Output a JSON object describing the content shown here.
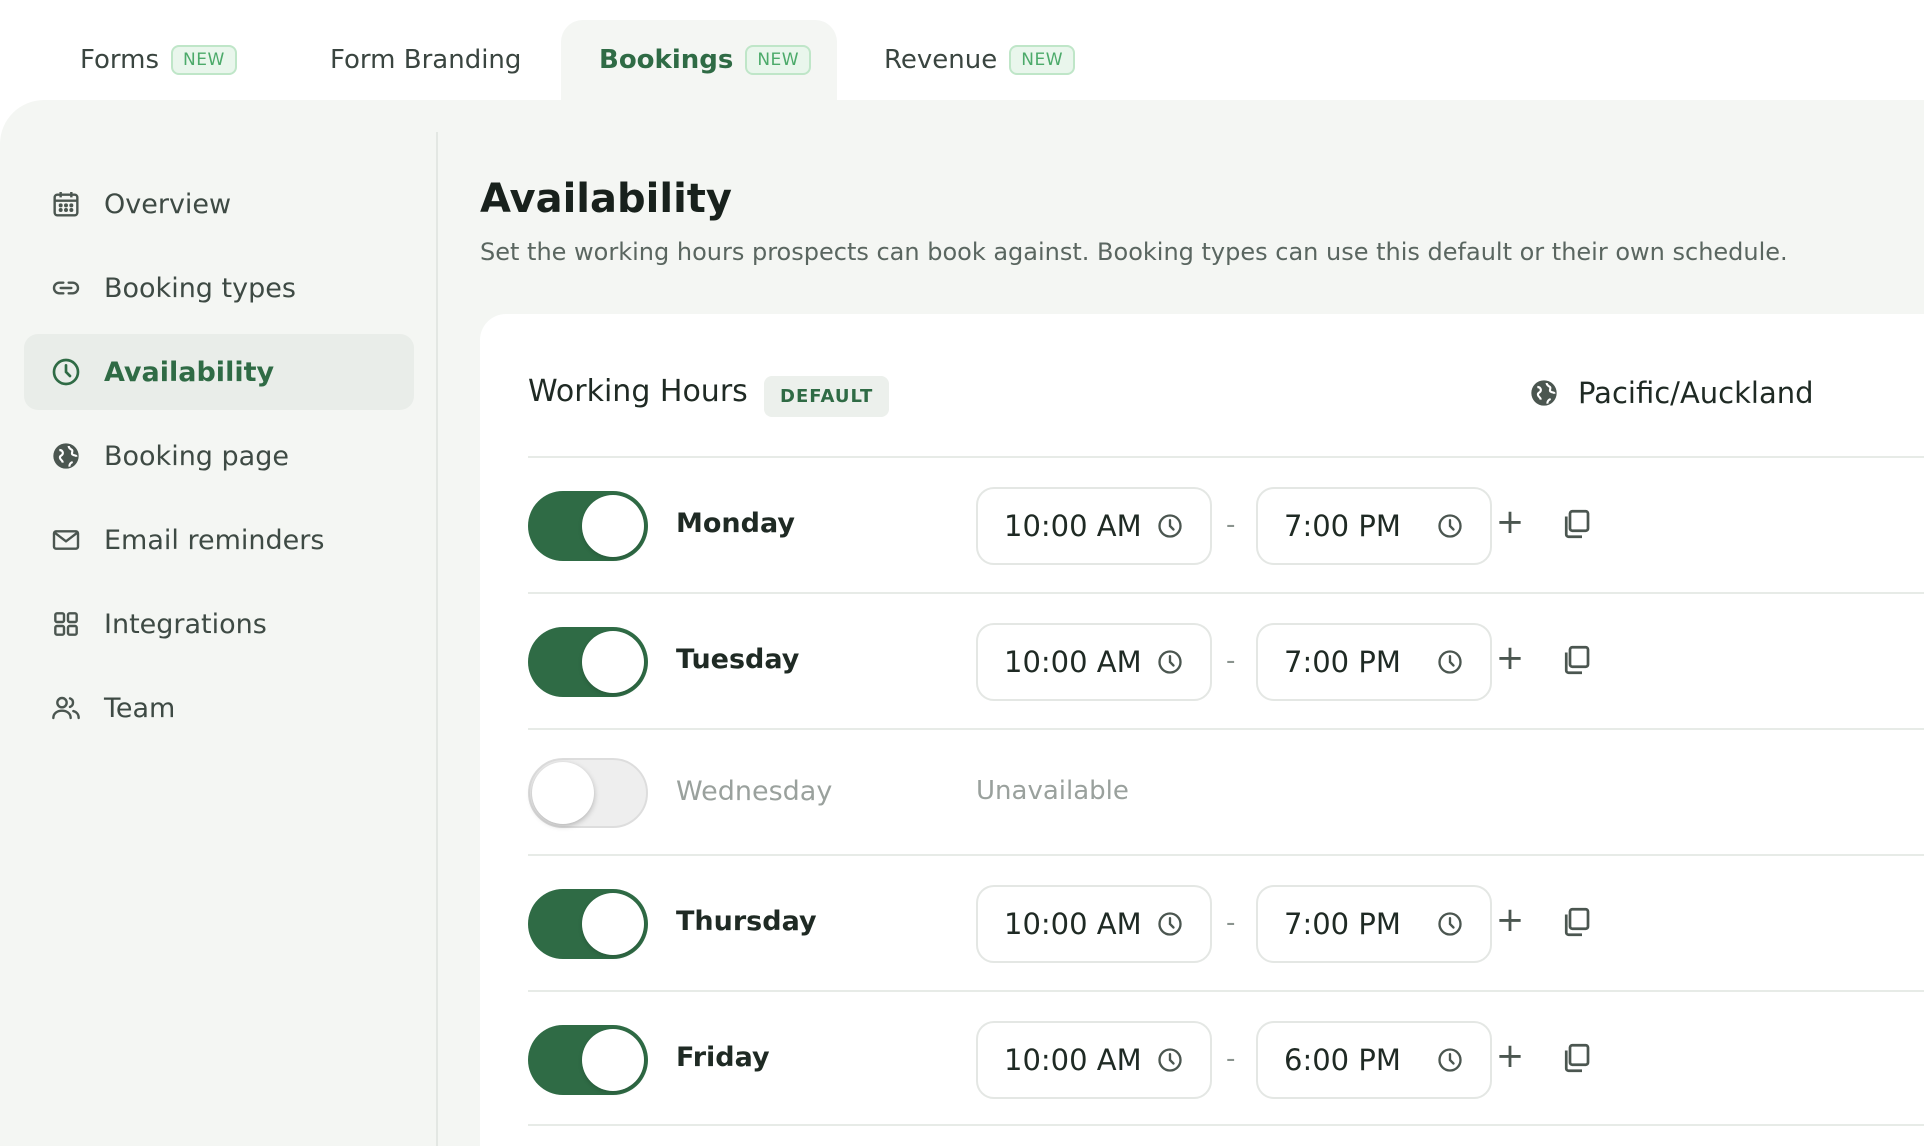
{
  "tabs": [
    {
      "label": "Forms",
      "badge": "NEW"
    },
    {
      "label": "Form Branding",
      "badge": ""
    },
    {
      "label": "Bookings",
      "badge": "NEW"
    },
    {
      "label": "Revenue",
      "badge": "NEW"
    }
  ],
  "sidebar": {
    "items": [
      {
        "label": "Overview",
        "icon": "calendar-icon"
      },
      {
        "label": "Booking types",
        "icon": "link-icon"
      },
      {
        "label": "Availability",
        "icon": "clock-icon"
      },
      {
        "label": "Booking page",
        "icon": "globe-icon"
      },
      {
        "label": "Email reminders",
        "icon": "mail-icon"
      },
      {
        "label": "Integrations",
        "icon": "grid-icon"
      },
      {
        "label": "Team",
        "icon": "users-icon"
      }
    ]
  },
  "main": {
    "title": "Availability",
    "description": "Set the working hours prospects can book against. Booking types can use this default or their own schedule."
  },
  "card": {
    "title": "Working Hours",
    "badge": "DEFAULT",
    "timezone": "Pacific/Auckland"
  },
  "schedule": {
    "separator": "-",
    "add_label": "+",
    "days": [
      {
        "day": "Monday",
        "enabled": true,
        "start": "10:00 AM",
        "end": "7:00 PM"
      },
      {
        "day": "Tuesday",
        "enabled": true,
        "start": "10:00 AM",
        "end": "7:00 PM"
      },
      {
        "day": "Wednesday",
        "enabled": false,
        "status": "Unavailable"
      },
      {
        "day": "Thursday",
        "enabled": true,
        "start": "10:00 AM",
        "end": "7:00 PM"
      },
      {
        "day": "Friday",
        "enabled": true,
        "start": "10:00 AM",
        "end": "6:00 PM"
      }
    ]
  },
  "colors": {
    "accent": "#2f6b45",
    "badge_green": "#4caa6a",
    "panel_bg": "#f4f6f3"
  }
}
